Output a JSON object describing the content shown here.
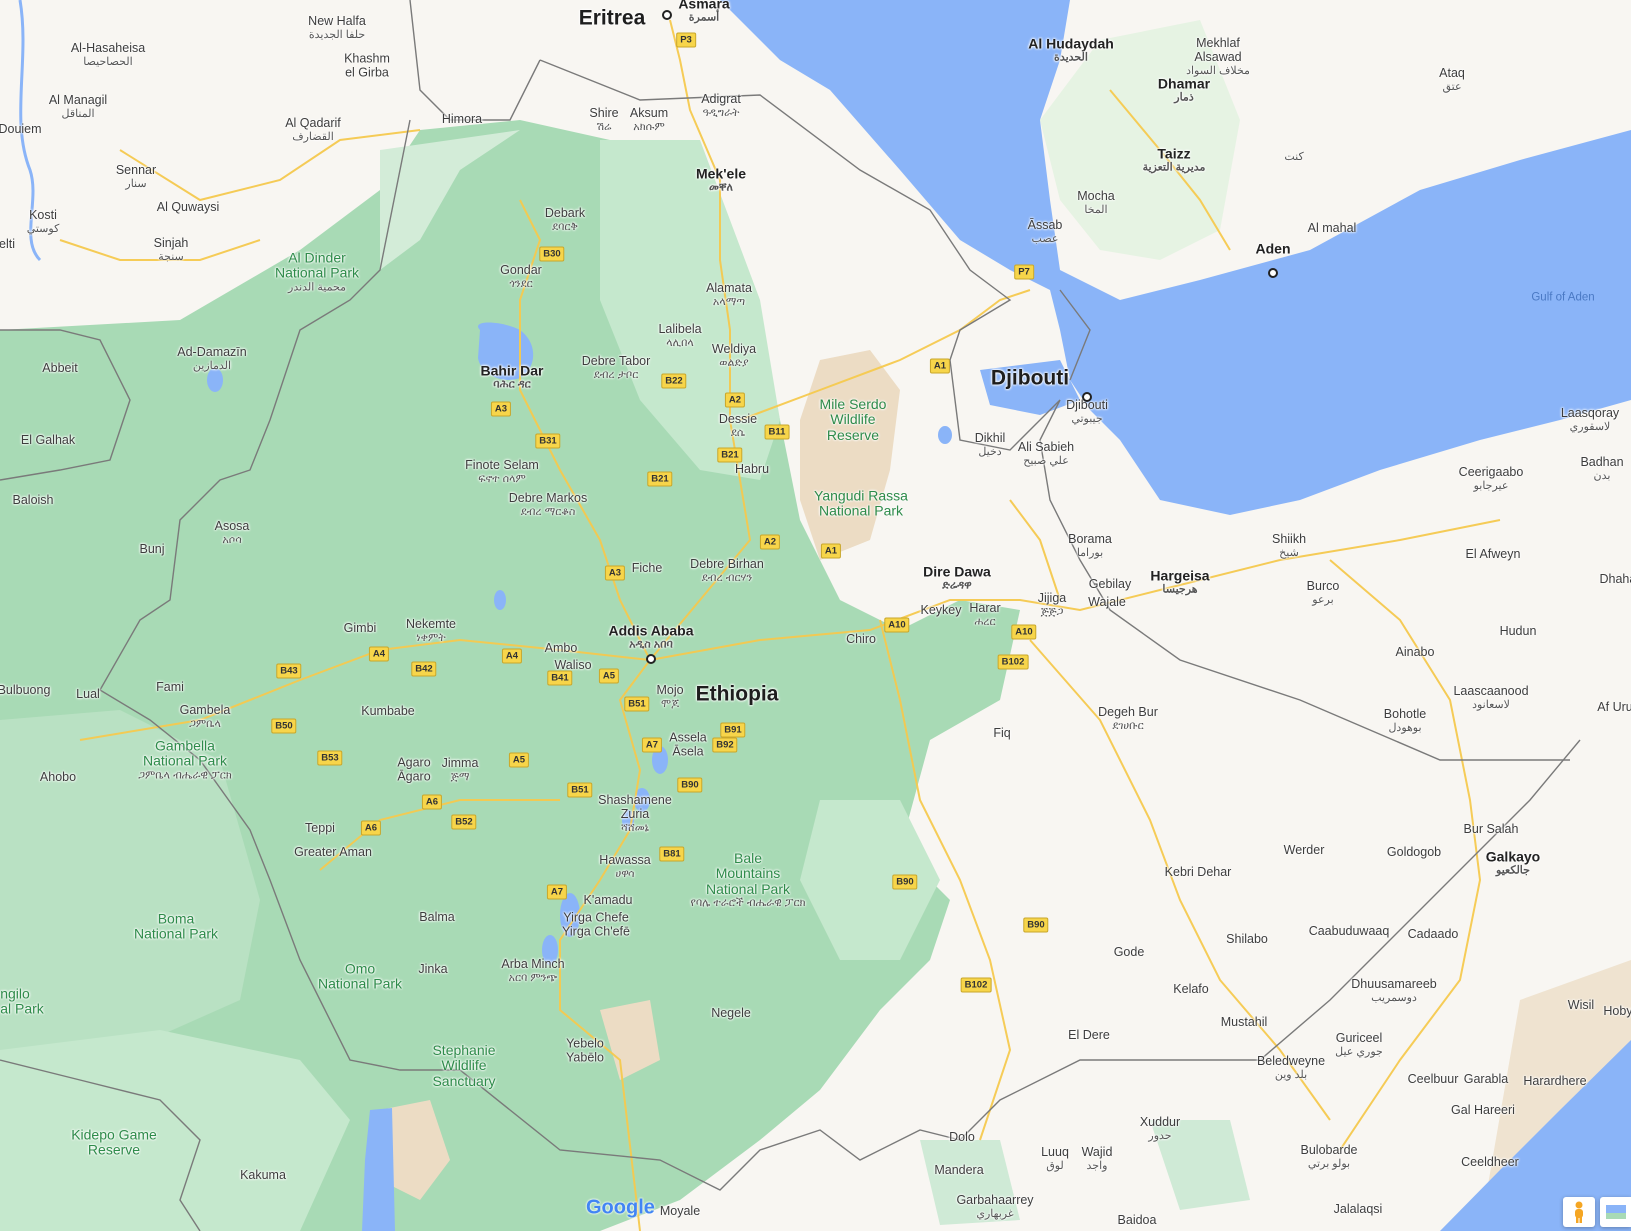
{
  "map": {
    "provider": "Google",
    "colors": {
      "land": "#f8f6f2",
      "vegetation": "#a8dab5",
      "vegetation_light": "#c5e8cd",
      "desert": "#ecdcc4",
      "water": "#8ab4f8",
      "road": "#f5c94e",
      "border": "#777777"
    },
    "countries": [
      {
        "id": "eritrea",
        "name": "Eritrea"
      },
      {
        "id": "djibouti",
        "name": "Djibouti"
      },
      {
        "id": "ethiopia",
        "name": "Ethiopia"
      }
    ],
    "water_labels": [
      {
        "id": "gulf-of-aden",
        "name": "Gulf of Aden"
      }
    ],
    "parks": [
      {
        "id": "al-dinder",
        "name": "Al Dinder\nNational Park",
        "sub": "محمية الدندر"
      },
      {
        "id": "mile-serdo",
        "name": "Mile Serdo\nWildlife\nReserve"
      },
      {
        "id": "yangudi-rassa",
        "name": "Yangudi Rassa\nNational Park"
      },
      {
        "id": "gambella",
        "name": "Gambella\nNational Park",
        "sub": "ጋምቤላ ብሔራዊ ፓርክ"
      },
      {
        "id": "bale",
        "name": "Bale\nMountains\nNational Park",
        "sub": "የባሌ ተራሮች ብሔራዊ ፓርክ"
      },
      {
        "id": "boma",
        "name": "Boma\nNational Park"
      },
      {
        "id": "omo",
        "name": "Omo\nNational Park"
      },
      {
        "id": "stephanie",
        "name": "Stephanie\nWildlife\nSanctuary"
      },
      {
        "id": "kidepo",
        "name": "Kidepo Game\nReserve"
      },
      {
        "id": "angilo",
        "name": "ngilo\nal Park"
      }
    ],
    "cities": [
      {
        "id": "asmara",
        "name": "Asmara",
        "sub": "أسمرة",
        "major": true
      },
      {
        "id": "new-halfa",
        "name": "New Halfa",
        "sub": "حلفا الجديدة"
      },
      {
        "id": "al-hasaheisa",
        "name": "Al-Hasaheisa",
        "sub": "الحصاحيصا"
      },
      {
        "id": "khashm-el-girba",
        "name": "Khashm\nel Girba"
      },
      {
        "id": "al-managil",
        "name": "Al Managil",
        "sub": "المناقل"
      },
      {
        "id": "al-qadarif",
        "name": "Al Qadarif",
        "sub": "القضارف"
      },
      {
        "id": "himora",
        "name": "Himora"
      },
      {
        "id": "douiem",
        "name": "Douiem"
      },
      {
        "id": "sennar",
        "name": "Sennar",
        "sub": "سنار"
      },
      {
        "id": "al-quwaysi",
        "name": "Al Quwaysi"
      },
      {
        "id": "kosti",
        "name": "Kosti",
        "sub": "كوستي"
      },
      {
        "id": "sinjah",
        "name": "Sinjah",
        "sub": "سنجة"
      },
      {
        "id": "elti",
        "name": "elti"
      },
      {
        "id": "ad-damazin",
        "name": "Ad-Damazīn",
        "sub": "الدمازين"
      },
      {
        "id": "abbeit",
        "name": "Abbeit"
      },
      {
        "id": "el-galhak",
        "name": "El Galhak"
      },
      {
        "id": "baloish",
        "name": "Baloish"
      },
      {
        "id": "bunj",
        "name": "Bunj"
      },
      {
        "id": "asosa",
        "name": "Asosa",
        "sub": "አሶሳ"
      },
      {
        "id": "bulbuong",
        "name": "Bulbuong"
      },
      {
        "id": "lual",
        "name": "Lual"
      },
      {
        "id": "fami",
        "name": "Fami"
      },
      {
        "id": "ahobo",
        "name": "Ahobo"
      },
      {
        "id": "gambela",
        "name": "Gambela",
        "sub": "ጋምቤላ"
      },
      {
        "id": "gimbi",
        "name": "Gimbi"
      },
      {
        "id": "nekemte",
        "name": "Nekemte",
        "sub": "ነቀምት"
      },
      {
        "id": "kumbabe",
        "name": "Kumbabe"
      },
      {
        "id": "agaro",
        "name": "Agaro\nĀgaro"
      },
      {
        "id": "jimma",
        "name": "Jimma",
        "sub": "ጅማ"
      },
      {
        "id": "teppi",
        "name": "Teppi"
      },
      {
        "id": "greater-aman",
        "name": "Greater Aman"
      },
      {
        "id": "balma",
        "name": "Balma"
      },
      {
        "id": "jinka",
        "name": "Jinka"
      },
      {
        "id": "kakuma",
        "name": "Kakuma"
      },
      {
        "id": "shire",
        "name": "Shire",
        "sub": "ሽሬ"
      },
      {
        "id": "aksum",
        "name": "Aksum",
        "sub": "አክሱም"
      },
      {
        "id": "adigrat",
        "name": "Adigrat",
        "sub": "ዓዲግራት"
      },
      {
        "id": "mekele",
        "name": "Mek'ele",
        "sub": "መቐለ",
        "major": true
      },
      {
        "id": "debark",
        "name": "Debark",
        "sub": "ደባርቅ"
      },
      {
        "id": "gondar",
        "name": "Gondar",
        "sub": "ጎንደር"
      },
      {
        "id": "alamata",
        "name": "Alamata",
        "sub": "አላማጣ"
      },
      {
        "id": "lalibela",
        "name": "Lalibela",
        "sub": "ላሊበላ"
      },
      {
        "id": "weldiya",
        "name": "Weldiya",
        "sub": "ወልድያ"
      },
      {
        "id": "bahir-dar",
        "name": "Bahir Dar",
        "sub": "ባሕር ዳር",
        "major": true
      },
      {
        "id": "debre-tabor",
        "name": "Debre Tabor",
        "sub": "ደብረ ታቦር"
      },
      {
        "id": "dessie",
        "name": "Dessie",
        "sub": "ደሴ"
      },
      {
        "id": "habru",
        "name": "Habru"
      },
      {
        "id": "finote-selam",
        "name": "Finote Selam",
        "sub": "ፍኖተ ሰላም"
      },
      {
        "id": "debre-markos",
        "name": "Debre Markos",
        "sub": "ደብረ ማርቆስ"
      },
      {
        "id": "fiche",
        "name": "Fiche"
      },
      {
        "id": "debre-birhan",
        "name": "Debre Birhan",
        "sub": "ደብረ ብርሃን"
      },
      {
        "id": "addis-ababa",
        "name": "Addis Ababa",
        "sub": "አዲስ አበባ",
        "major": true
      },
      {
        "id": "ambo",
        "name": "Ambo"
      },
      {
        "id": "waliso",
        "name": "Waliso"
      },
      {
        "id": "mojo",
        "name": "Mojo",
        "sub": "ሞጆ"
      },
      {
        "id": "assela",
        "name": "Assela\nĀsela"
      },
      {
        "id": "shashamene",
        "name": "Shashamene\nZuria",
        "sub": "ሻሸመኔ"
      },
      {
        "id": "hawassa",
        "name": "Hawassa",
        "sub": "ሀዋሳ"
      },
      {
        "id": "kamadu",
        "name": "K'amadu"
      },
      {
        "id": "yirga-chefe",
        "name": "Yirga Chefe\nYirga Ch'efē"
      },
      {
        "id": "arba-minch",
        "name": "Arba Minch",
        "sub": "አርባ ምንጭ"
      },
      {
        "id": "negele",
        "name": "Negele"
      },
      {
        "id": "yabelo",
        "name": "Yebelo\nYabēlo"
      },
      {
        "id": "moyale",
        "name": "Moyale"
      },
      {
        "id": "chiro",
        "name": "Chiro"
      },
      {
        "id": "dire-dawa",
        "name": "Dire Dawa",
        "sub": "ድሬዳዋ",
        "major": true
      },
      {
        "id": "keykey",
        "name": "Keykey"
      },
      {
        "id": "harar",
        "name": "Harar",
        "sub": "ሐረር"
      },
      {
        "id": "jijiga",
        "name": "Jijiga",
        "sub": "ጅጅጋ"
      },
      {
        "id": "fiq",
        "name": "Fiq"
      },
      {
        "id": "degeh-bur",
        "name": "Degeh Bur",
        "sub": "ደገሀቡር"
      },
      {
        "id": "kebri-dehar",
        "name": "Kebri Dehar"
      },
      {
        "id": "werder",
        "name": "Werder"
      },
      {
        "id": "gode",
        "name": "Gode"
      },
      {
        "id": "shilabo",
        "name": "Shilabo"
      },
      {
        "id": "kelafo",
        "name": "Kelafo"
      },
      {
        "id": "el-dere",
        "name": "El Dere"
      },
      {
        "id": "mustahil",
        "name": "Mustahil"
      },
      {
        "id": "dolo",
        "name": "Dolo"
      },
      {
        "id": "mandera",
        "name": "Mandera"
      },
      {
        "id": "luuq",
        "name": "Luuq",
        "sub": "لوق"
      },
      {
        "id": "wajid",
        "name": "Wajid",
        "sub": "واجد"
      },
      {
        "id": "xuddur",
        "name": "Xuddur",
        "sub": "حدور"
      },
      {
        "id": "garbahaarrey",
        "name": "Garbahaarrey",
        "sub": "غربهاري"
      },
      {
        "id": "baidoa",
        "name": "Baidoa"
      },
      {
        "id": "djibouti-city",
        "name": "Djibouti",
        "sub": "جيبوتي"
      },
      {
        "id": "dikhil",
        "name": "Dikhil",
        "sub": "دخيل"
      },
      {
        "id": "ali-sabieh",
        "name": "Ali Sabieh",
        "sub": "علي صبيح"
      },
      {
        "id": "assab",
        "name": "Āssab",
        "sub": "عصب"
      },
      {
        "id": "borama",
        "name": "Borama",
        "sub": "بوراما"
      },
      {
        "id": "gebilay",
        "name": "Gebilay"
      },
      {
        "id": "wajale",
        "name": "Wajale"
      },
      {
        "id": "hargeisa",
        "name": "Hargeisa",
        "sub": "هرجيسا",
        "major": true
      },
      {
        "id": "shiikh",
        "name": "Shiikh",
        "sub": "شيخ"
      },
      {
        "id": "burco",
        "name": "Burco",
        "sub": "برعو"
      },
      {
        "id": "ceerigaabo",
        "name": "Ceerigaabo",
        "sub": "عيرجابو"
      },
      {
        "id": "el-afweyn",
        "name": "El Afweyn"
      },
      {
        "id": "laasqoray",
        "name": "Laasqoray",
        "sub": "لاسقوري"
      },
      {
        "id": "badhan",
        "name": "Badhan",
        "sub": "بدن"
      },
      {
        "id": "dhahar",
        "name": "Dhahar"
      },
      {
        "id": "ainabo",
        "name": "Ainabo"
      },
      {
        "id": "hudun",
        "name": "Hudun"
      },
      {
        "id": "laascaanood",
        "name": "Laascaanood",
        "sub": "لاسعانود"
      },
      {
        "id": "bohotle",
        "name": "Bohotle",
        "sub": "بوهودل"
      },
      {
        "id": "af-urur",
        "name": "Af Uru"
      },
      {
        "id": "bur-salah",
        "name": "Bur Salah"
      },
      {
        "id": "goldogob",
        "name": "Goldogob"
      },
      {
        "id": "galkayo",
        "name": "Galkayo",
        "sub": "جالكعيو",
        "major": true
      },
      {
        "id": "caabuduwaaq",
        "name": "Caabuduwaaq"
      },
      {
        "id": "cadaado",
        "name": "Cadaado"
      },
      {
        "id": "dhuusamareeb",
        "name": "Dhuusamareeb",
        "sub": "دوسمريب"
      },
      {
        "id": "wisil",
        "name": "Wisil"
      },
      {
        "id": "hoby",
        "name": "Hoby"
      },
      {
        "id": "guriceel",
        "name": "Guriceel",
        "sub": "جوري عيل"
      },
      {
        "id": "beledweyne",
        "name": "Beledweyne",
        "sub": "بلد وين"
      },
      {
        "id": "ceelbuur",
        "name": "Ceelbuur"
      },
      {
        "id": "garabla",
        "name": "Garabla"
      },
      {
        "id": "harardhere",
        "name": "Harardhere"
      },
      {
        "id": "gal-hareeri",
        "name": "Gal Hareeri"
      },
      {
        "id": "bulobarde",
        "name": "Bulobarde",
        "sub": "بولو برتي"
      },
      {
        "id": "ceeldheer",
        "name": "Ceeldheer"
      },
      {
        "id": "jalalaqsi",
        "name": "Jalalaqsi"
      },
      {
        "id": "al-hudaydah",
        "name": "Al Hudaydah",
        "sub": "الحديدة",
        "major": true
      },
      {
        "id": "mekhlaf",
        "name": "Mekhlaf\nAlsawad",
        "sub": "مخلاف السواد"
      },
      {
        "id": "dhamar",
        "name": "Dhamar",
        "sub": "ذمار",
        "major": true
      },
      {
        "id": "ataq",
        "name": "Ataq",
        "sub": "عتق"
      },
      {
        "id": "taizz",
        "name": "Taizz",
        "sub": "مديرية التعزية",
        "major": true
      },
      {
        "id": "mocha",
        "name": "Mocha",
        "sub": "المخا"
      },
      {
        "id": "kent",
        "name": "",
        "sub": "كنت"
      },
      {
        "id": "al-mahal",
        "name": "Al mahal"
      },
      {
        "id": "aden",
        "name": "Aden",
        "major": true
      }
    ],
    "roads": [
      "P3",
      "B30",
      "B22",
      "A3",
      "B31",
      "B21",
      "A2",
      "B11",
      "B21",
      "A2",
      "A1",
      "A1",
      "A3",
      "A4",
      "A4",
      "B43",
      "B42",
      "B41",
      "A5",
      "B51",
      "B50",
      "B53",
      "A6",
      "A6",
      "B52",
      "A5",
      "B51",
      "A7",
      "B91",
      "B92",
      "B90",
      "B81",
      "A7",
      "A10",
      "A10",
      "B102",
      "B90",
      "B90",
      "B102",
      "P7"
    ],
    "footer": {
      "logo": "Google"
    }
  }
}
